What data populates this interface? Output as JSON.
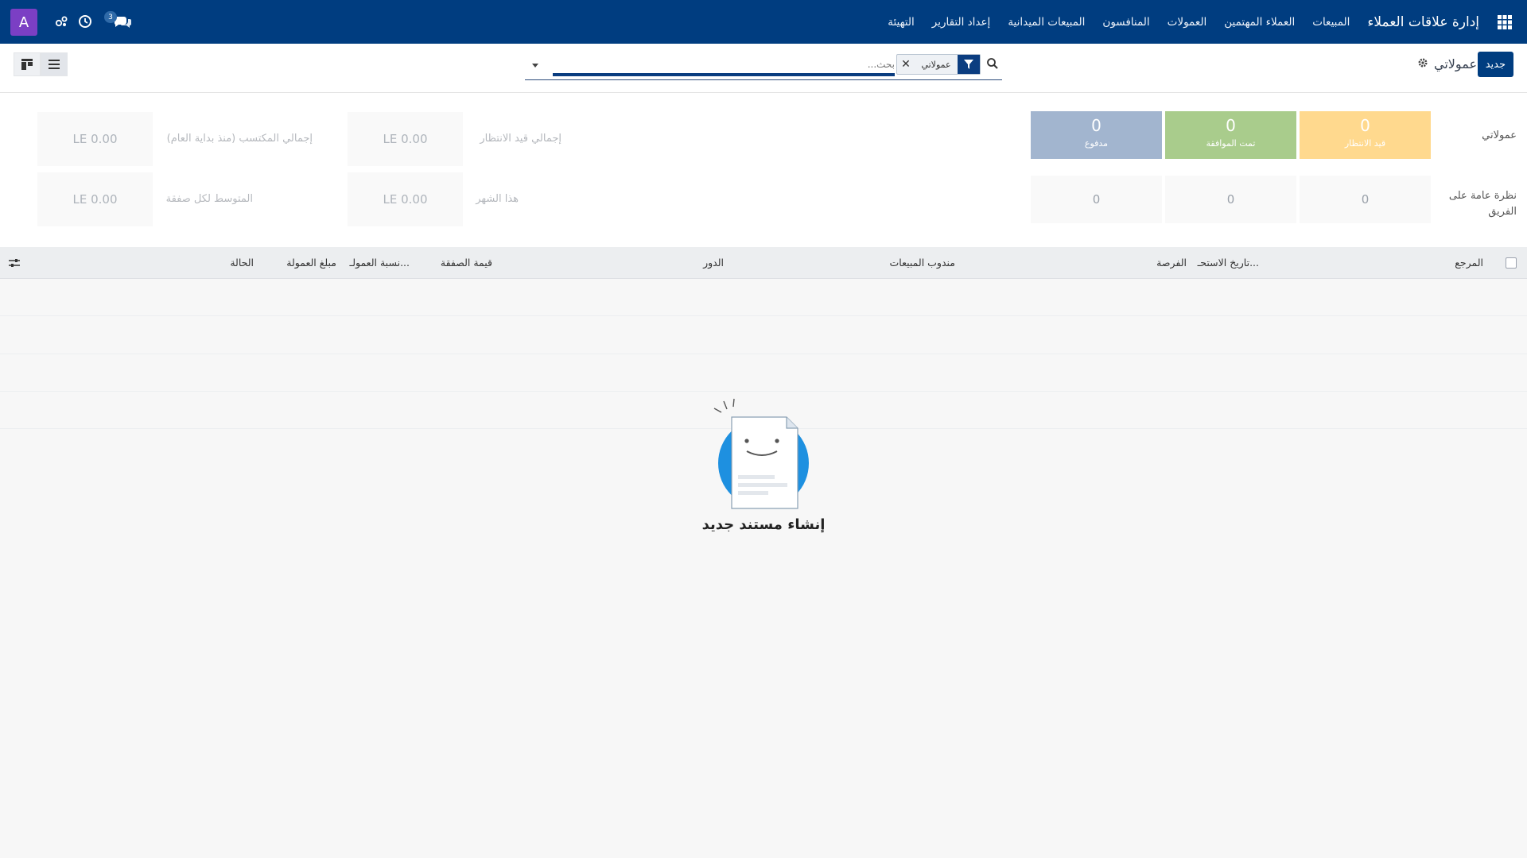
{
  "navbar": {
    "user_initial": "A",
    "chat_count": "3",
    "brand": "إدارة علاقات العملاء",
    "menu": [
      "المبيعات",
      "العملاء المهتمين",
      "العمولات",
      "المنافسون",
      "المبيعات الميدانية",
      "إعداد التقارير",
      "التهيئة"
    ]
  },
  "control": {
    "new_button": "جديد",
    "title": "عمولاتي",
    "search_placeholder": "بحث...",
    "facet_label": "عمولاتي"
  },
  "dashboard": {
    "row1_label": "عمولاتي",
    "row2_label": "نظرة عامة على الفريق",
    "stats": [
      {
        "value": "0",
        "label": "قيد الانتظار",
        "color": "#ffd98e"
      },
      {
        "value": "0",
        "label": "تمت الموافقة",
        "color": "#a9cc8c"
      },
      {
        "value": "0",
        "label": "مدفوع",
        "color": "#a2b5cf"
      }
    ],
    "team_stats": [
      "0",
      "0",
      "0"
    ],
    "pending_total_label": "إجمالي قيد الانتظار",
    "pending_total_value": "LE 0.00",
    "earned_total_label": "إجمالي المكتسب (منذ بداية العام)",
    "earned_total_value": "LE 0.00",
    "this_month_label": "هذا الشهر",
    "this_month_value": "LE 0.00",
    "avg_deal_label": "المتوسط لكل صفقة",
    "avg_deal_value": "LE 0.00"
  },
  "table": {
    "columns": [
      "المرجع",
      "تاريخ الاستحـ...",
      "الفرصة",
      "مندوب المبيعات",
      "الدور",
      "قيمة الصفقة",
      "نسبة العمولـ...",
      "مبلغ العمولة",
      "الحالة"
    ]
  },
  "empty_state": {
    "title": "إنشاء مستند جديد"
  }
}
